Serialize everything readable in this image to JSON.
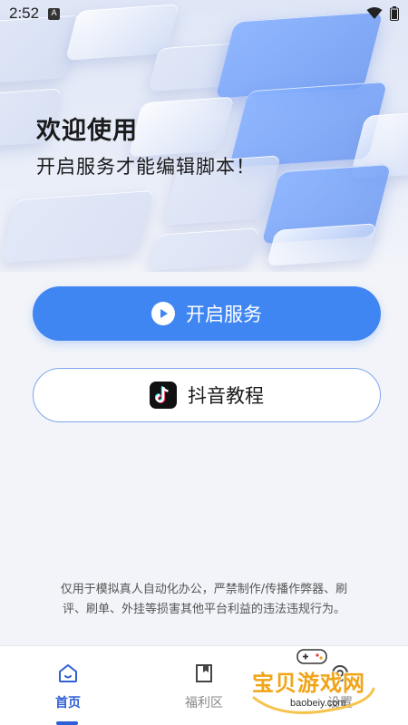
{
  "status_bar": {
    "time": "2:52",
    "a_badge": "A"
  },
  "welcome": {
    "title": "欢迎使用",
    "subtitle": "开启服务才能编辑脚本！"
  },
  "buttons": {
    "start_service": "开启服务",
    "douyin_tutorial": "抖音教程"
  },
  "disclaimer": {
    "line1": "仅用于模拟真人自动化办公，严禁制作/传播作弊器、刷",
    "line2": "评、刷单、外挂等损害其他平台利益的违法违规行为。"
  },
  "bottom_nav": {
    "items": [
      {
        "label": "首页",
        "icon": "home-icon",
        "active": true
      },
      {
        "label": "福利区",
        "icon": "bookmark-icon",
        "active": false
      },
      {
        "label": "设置",
        "icon": "settings-icon",
        "active": false
      }
    ]
  },
  "watermark": {
    "text": "宝贝游戏网",
    "url": "baobeiy.com"
  },
  "colors": {
    "primary": "#3f86f2",
    "nav_active": "#2f5fd6",
    "watermark": "#f0a417"
  }
}
